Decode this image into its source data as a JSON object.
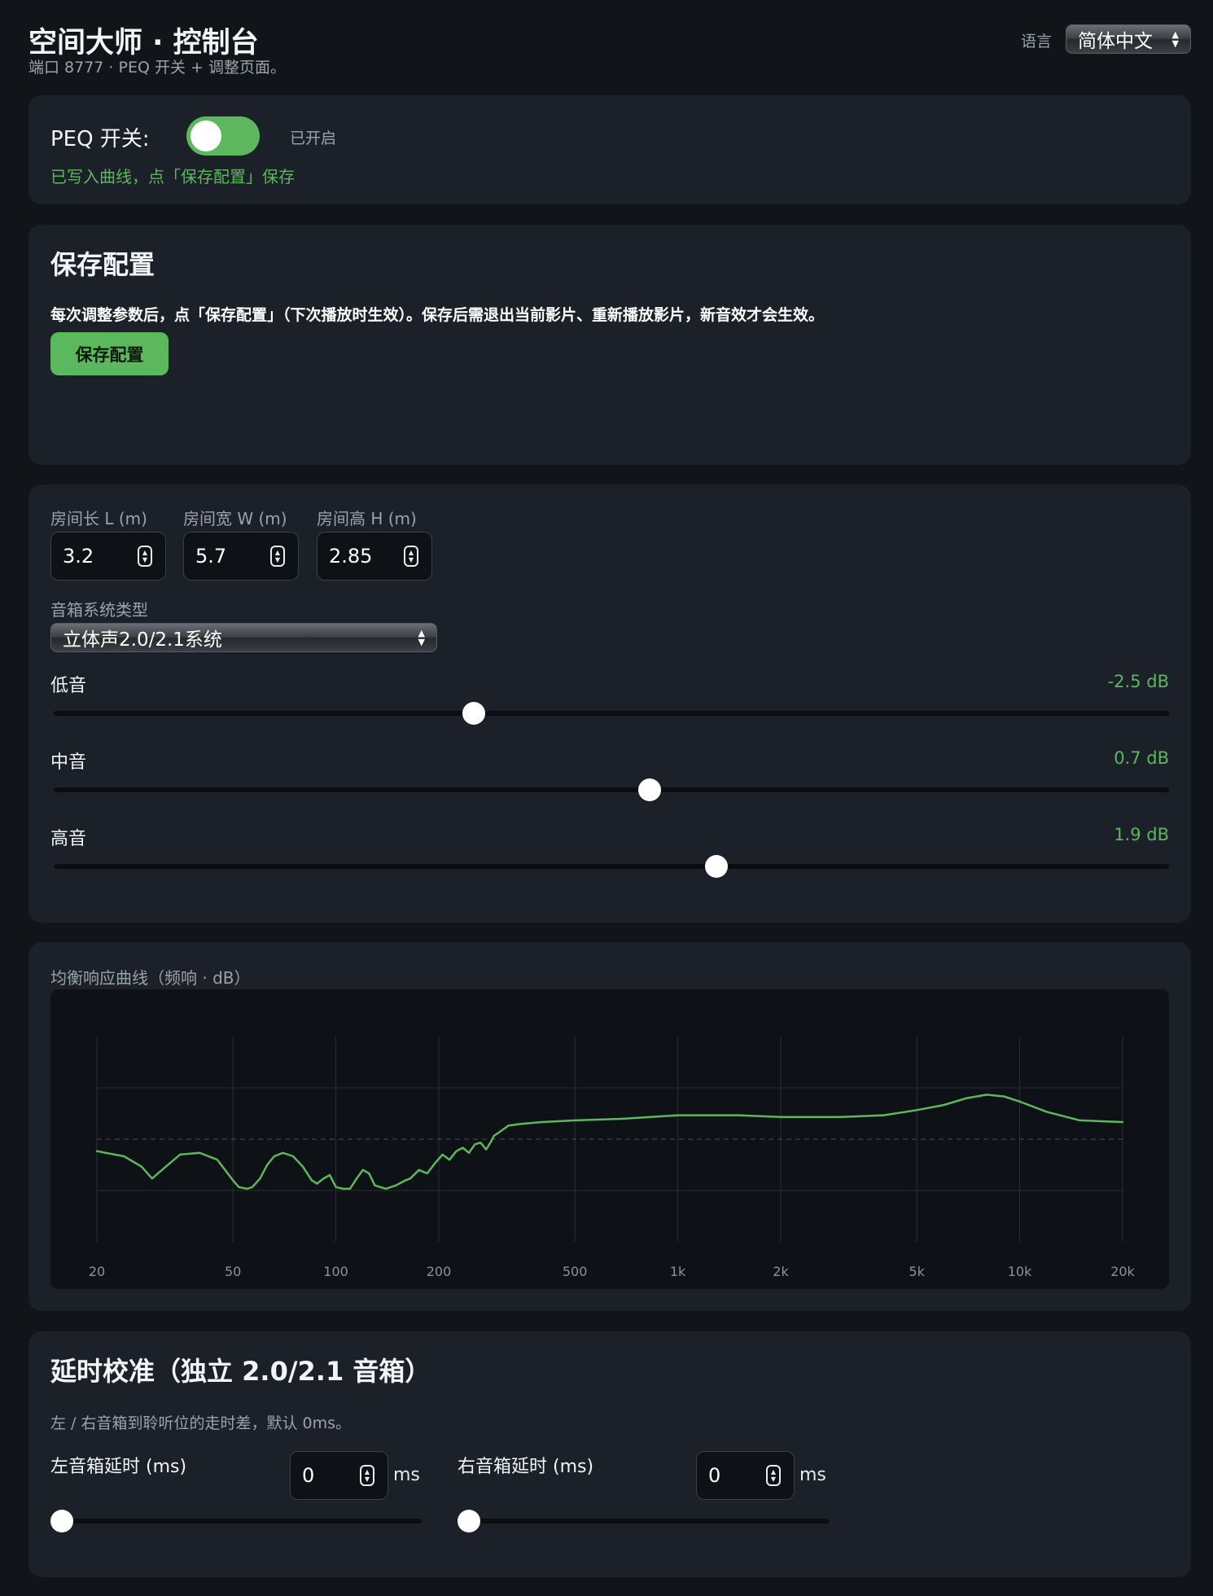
{
  "header": {
    "title": "空间大师 · 控制台",
    "subtitle": "端口 8777 · PEQ 开关 + 调整页面。",
    "language_label": "语言",
    "language_value": "简体中文"
  },
  "peq": {
    "label": "PEQ 开关:",
    "state": "已开启",
    "enabled": true,
    "message": "已写入曲线，点「保存配置」保存"
  },
  "save": {
    "title": "保存配置",
    "description": "每次调整参数后，点「保存配置」（下次播放时生效）。保存后需退出当前影片、重新播放影片，新音效才会生效。",
    "button": "保存配置"
  },
  "room": {
    "length_label": "房间长 L (m)",
    "length_value": "3.2",
    "width_label": "房间宽 W (m)",
    "width_value": "5.7",
    "height_label": "房间高 H (m)",
    "height_value": "2.85",
    "system_label": "音箱系统类型",
    "system_value": "立体声2.0/2.1系统"
  },
  "eq": {
    "bass": {
      "label": "低音",
      "value_text": "-2.5 dB",
      "fraction": 0.377
    },
    "mid": {
      "label": "中音",
      "value_text": "0.7 dB",
      "fraction": 0.534
    },
    "treble": {
      "label": "高音",
      "value_text": "1.9 dB",
      "fraction": 0.594
    }
  },
  "chart_data": {
    "type": "line",
    "title": "均衡响应曲线（频响 · dB）",
    "x_scale": "log",
    "xlim": [
      20,
      20000
    ],
    "x_tick_labels": [
      "20",
      "50",
      "100",
      "200",
      "500",
      "1k",
      "2k",
      "5k",
      "10k",
      "20k"
    ],
    "x_ticks": [
      20,
      50,
      100,
      200,
      500,
      1000,
      2000,
      5000,
      10000,
      20000
    ],
    "ylim": [
      -6,
      6
    ],
    "y_gridlines": [
      -6,
      -3,
      0,
      3,
      6
    ],
    "reference_line": 0,
    "grid": true,
    "series": [
      {
        "color": "#5cb85c",
        "x": [
          20,
          24,
          27,
          29,
          31,
          35,
          40,
          45,
          50,
          52,
          55,
          57,
          60,
          63,
          66,
          70,
          75,
          80,
          85,
          88,
          92,
          96,
          100,
          105,
          110,
          115,
          120,
          125,
          130,
          140,
          150,
          160,
          165,
          175,
          185,
          195,
          205,
          215,
          225,
          235,
          245,
          255,
          265,
          275,
          285,
          290,
          300,
          320,
          350,
          400,
          500,
          700,
          1000,
          1500,
          2000,
          3000,
          4000,
          5000,
          6000,
          7000,
          8000,
          9000,
          10000,
          12000,
          15000,
          20000
        ],
        "y": [
          -0.7,
          -1.0,
          -1.6,
          -2.3,
          -1.8,
          -0.9,
          -0.8,
          -1.2,
          -2.4,
          -2.8,
          -2.9,
          -2.8,
          -2.3,
          -1.5,
          -1.0,
          -0.8,
          -1.0,
          -1.6,
          -2.4,
          -2.6,
          -2.3,
          -2.1,
          -2.8,
          -2.9,
          -2.9,
          -2.3,
          -1.8,
          -2.0,
          -2.7,
          -2.9,
          -2.7,
          -2.4,
          -2.3,
          -1.8,
          -2.0,
          -1.4,
          -0.9,
          -1.2,
          -0.7,
          -0.5,
          -0.8,
          -0.3,
          -0.2,
          -0.6,
          -0.1,
          0.2,
          0.4,
          0.8,
          0.9,
          1.0,
          1.1,
          1.2,
          1.4,
          1.4,
          1.3,
          1.3,
          1.4,
          1.7,
          2.0,
          2.4,
          2.6,
          2.5,
          2.2,
          1.6,
          1.1,
          1.0
        ]
      }
    ]
  },
  "delay": {
    "title": "延时校准（独立 2.0/2.1 音箱）",
    "description": "左 / 右音箱到聆听位的走时差，默认 0ms。",
    "left_label": "左音箱延时 (ms)",
    "left_value": "0",
    "left_fraction": 0,
    "right_label": "右音箱延时 (ms)",
    "right_value": "0",
    "right_fraction": 0,
    "unit": "ms"
  }
}
